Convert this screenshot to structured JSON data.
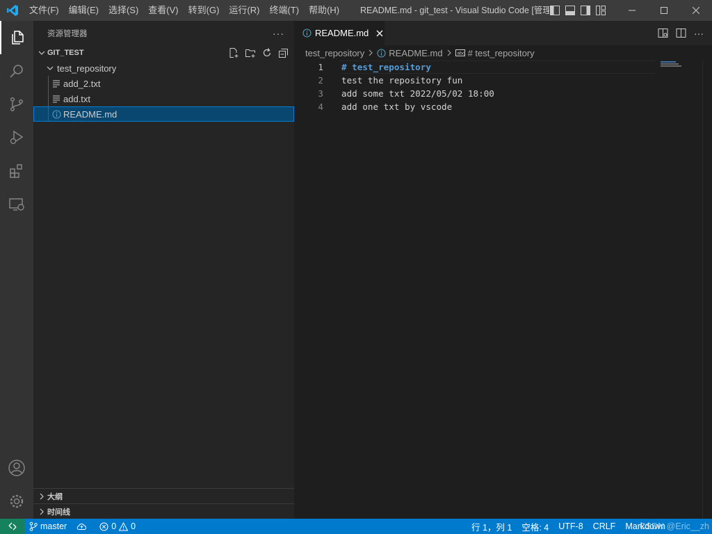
{
  "titlebar": {
    "menus": [
      "文件(F)",
      "编辑(E)",
      "选择(S)",
      "查看(V)",
      "转到(G)",
      "运行(R)",
      "终端(T)",
      "帮助(H)"
    ],
    "window_title": "README.md - git_test - Visual Studio Code [管理..."
  },
  "activitybar": {
    "items": [
      "explorer-icon",
      "search-icon",
      "source-control-icon",
      "run-debug-icon",
      "extensions-icon",
      "remote-explorer-icon"
    ],
    "bottom_items": [
      "account-icon",
      "gear-icon"
    ]
  },
  "sidebar": {
    "title": "资源管理器",
    "more": "···",
    "workspace": "GIT_TEST",
    "folder": "test_repository",
    "files": [
      "add_2.txt",
      "add.txt",
      "README.md"
    ],
    "outline_label": "大纲",
    "timeline_label": "时间线"
  },
  "editor": {
    "tab_label": "README.md",
    "breadcrumb": [
      "test_repository",
      "README.md",
      "# test_repository"
    ],
    "lines": [
      {
        "num": "1",
        "text": "# test_repository"
      },
      {
        "num": "2",
        "text": "test the repository fun"
      },
      {
        "num": "3",
        "text": "add some txt 2022/05/02 18:00"
      },
      {
        "num": "4",
        "text": "add one txt by vscode"
      }
    ]
  },
  "statusbar": {
    "branch": "master",
    "errors": "0",
    "warnings": "0",
    "position": "行 1，列 1",
    "indent": "空格: 4",
    "encoding": "UTF-8",
    "eol": "CRLF",
    "language": "Markdown",
    "watermark": "CSDN @Eric__zh"
  },
  "colors": {
    "accent": "#007acc",
    "remote": "#16825d",
    "selection": "#094771",
    "heading": "#569cd6"
  }
}
